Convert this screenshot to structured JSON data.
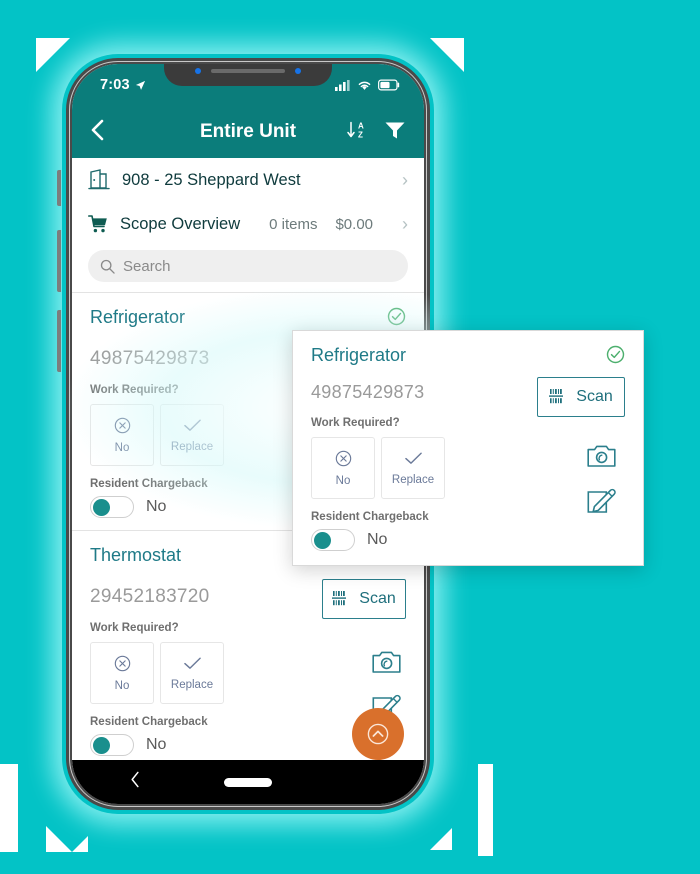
{
  "theme": {
    "background": "#03c3c6",
    "header_teal": "#0b7d7b",
    "accent_teal": "#1f7a87",
    "fab_orange": "#d9702c",
    "check_green": "#4caf6d",
    "toggle_on": "#1a8f8d"
  },
  "status_bar": {
    "time": "7:03",
    "location_icon": "location-arrow-icon",
    "signal_icon": "cellular-signal-icon",
    "wifi_icon": "wifi-icon",
    "battery_icon": "battery-icon"
  },
  "nav": {
    "back_icon": "back-chevron-icon",
    "title": "Entire Unit",
    "sort_icon": "sort-az-icon",
    "sort_label_a": "A",
    "sort_label_z": "Z",
    "filter_icon": "filter-funnel-icon"
  },
  "unit_row": {
    "icon": "building-door-icon",
    "label": "908 - 25 Sheppard West",
    "chevron": "›"
  },
  "scope_row": {
    "icon": "shopping-cart-icon",
    "label": "Scope Overview",
    "items": "0 items",
    "total": "$0.00",
    "chevron": "›"
  },
  "search": {
    "icon": "search-icon",
    "placeholder": "Search"
  },
  "assets": [
    {
      "title": "Refrigerator",
      "serial": "49875429873",
      "status_icon": "check-circle-icon",
      "work_required_label": "Work Required?",
      "options": [
        {
          "icon": "circle-x-icon",
          "label": "No"
        },
        {
          "icon": "checkmark-icon",
          "label": "Replace"
        }
      ],
      "chargeback_label": "Resident Chargeback",
      "chargeback_value": "No",
      "scan_label": "Scan",
      "scan_icon": "barcode-icon",
      "camera_icon": "camera-icon",
      "edit_icon": "edit-note-icon"
    },
    {
      "title": "Thermostat",
      "serial": "29452183720",
      "work_required_label": "Work Required?",
      "options": [
        {
          "icon": "circle-x-icon",
          "label": "No"
        },
        {
          "icon": "checkmark-icon",
          "label": "Replace"
        }
      ],
      "chargeback_label": "Resident Chargeback",
      "chargeback_value": "No",
      "scan_label": "Scan",
      "scan_icon": "barcode-icon",
      "camera_icon": "camera-icon",
      "edit_icon": "edit-note-icon"
    }
  ],
  "callout": {
    "title": "Refrigerator",
    "serial": "49875429873",
    "status_icon": "check-circle-icon",
    "work_required_label": "Work Required?",
    "options": [
      {
        "icon": "circle-x-icon",
        "label": "No"
      },
      {
        "icon": "checkmark-icon",
        "label": "Replace"
      }
    ],
    "chargeback_label": "Resident Chargeback",
    "chargeback_value": "No",
    "scan_label": "Scan",
    "scan_icon": "barcode-icon",
    "camera_icon": "camera-icon",
    "edit_icon": "edit-note-icon"
  },
  "fab": {
    "icon": "chevron-up-circle-icon"
  },
  "android_nav": {
    "back_icon": "android-back-icon",
    "home_icon": "android-home-pill"
  }
}
